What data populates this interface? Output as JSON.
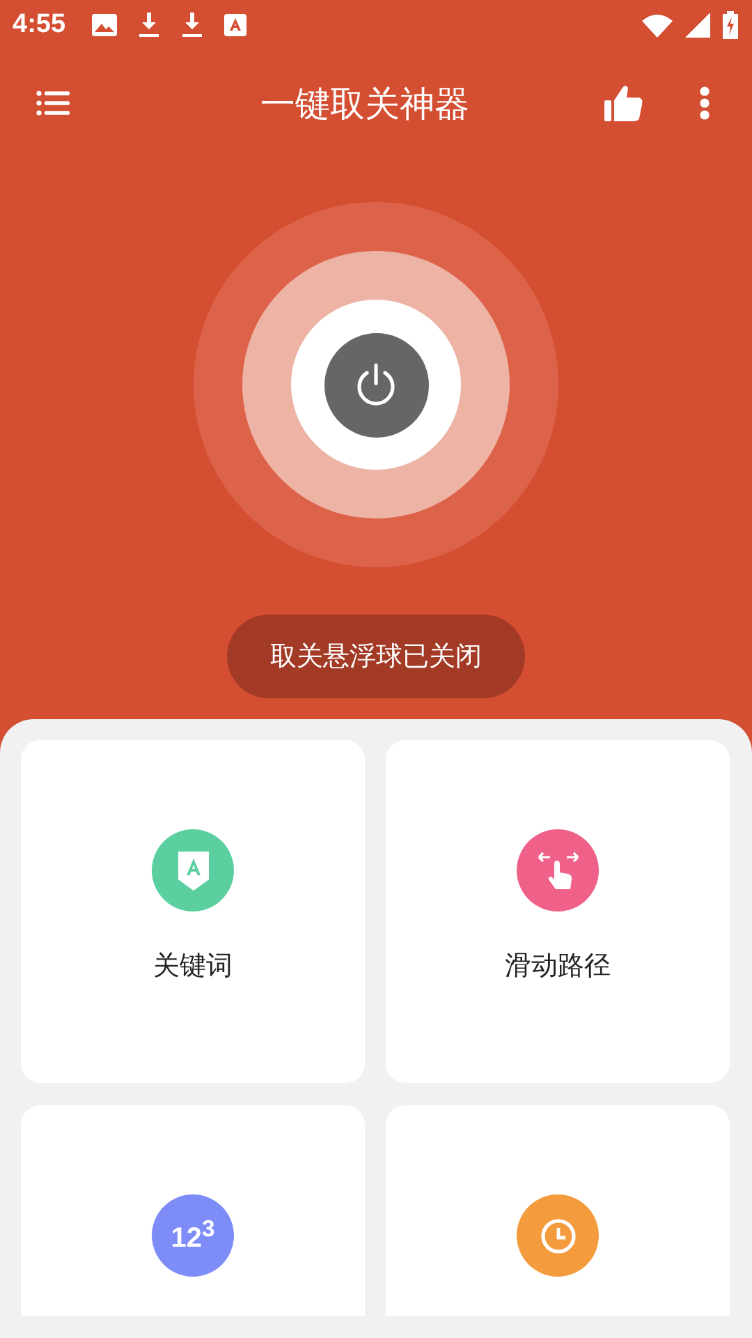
{
  "status_bar": {
    "time": "4:55"
  },
  "app_bar": {
    "title": "一键取关神器"
  },
  "power": {
    "on": false
  },
  "toast": "取关悬浮球已关闭",
  "cards": [
    {
      "kind": "keyword",
      "color": "#5bcf9f",
      "label": "关键词"
    },
    {
      "kind": "swipe",
      "color": "#ef6189",
      "label": "滑动路径"
    },
    {
      "kind": "counter",
      "color": "#7e8cf7",
      "icon_text": "12$^{3}$"
    },
    {
      "kind": "timer",
      "color": "#f39b3d"
    }
  ]
}
